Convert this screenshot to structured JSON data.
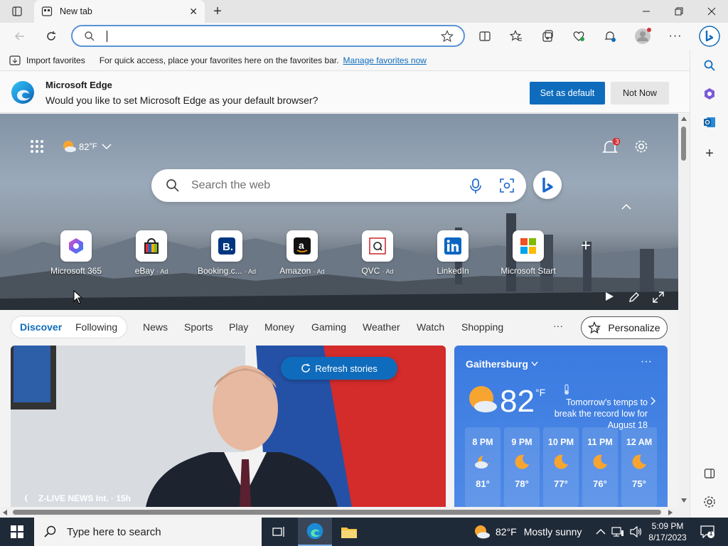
{
  "tab": {
    "title": "New tab"
  },
  "address": {
    "value": ""
  },
  "favorites_bar": {
    "import_label": "Import favorites",
    "message": "For quick access, place your favorites here on the favorites bar.",
    "manage_link": "Manage favorites now"
  },
  "banner": {
    "title": "Microsoft Edge",
    "message": "Would you like to set Microsoft Edge as your default browser?",
    "primary": "Set as default",
    "secondary": "Not Now"
  },
  "hero": {
    "weather": "82",
    "weather_unit": "°F",
    "search_placeholder": "Search the web",
    "notification_count": "3"
  },
  "tiles": [
    {
      "label": "Microsoft 365",
      "ad": ""
    },
    {
      "label": "eBay",
      "ad": "· Ad"
    },
    {
      "label": "Booking.c...",
      "ad": "· Ad"
    },
    {
      "label": "Amazon",
      "ad": "· Ad"
    },
    {
      "label": "QVC",
      "ad": "· Ad"
    },
    {
      "label": "LinkedIn",
      "ad": ""
    },
    {
      "label": "Microsoft Start",
      "ad": ""
    }
  ],
  "feed_nav": {
    "discover": "Discover",
    "following": "Following",
    "items": [
      "News",
      "Sports",
      "Play",
      "Money",
      "Gaming",
      "Weather",
      "Watch",
      "Shopping"
    ],
    "more": "···",
    "personalize": "Personalize"
  },
  "news": {
    "refresh": "Refresh stories",
    "source": "Z-LIVE NEWS Int. · 15h"
  },
  "weather_card": {
    "location": "Gaithersburg",
    "more": "···",
    "temp": "82",
    "unit": "°F",
    "note": "Tomorrow's temps to break the record low for August 18",
    "hourly": [
      {
        "time": "8 PM",
        "temp": "81°",
        "icon": "partly-cloudy-night-icon"
      },
      {
        "time": "9 PM",
        "temp": "78°",
        "icon": "moon-icon"
      },
      {
        "time": "10 PM",
        "temp": "77°",
        "icon": "moon-icon"
      },
      {
        "time": "11 PM",
        "temp": "76°",
        "icon": "moon-icon"
      },
      {
        "time": "12 AM",
        "temp": "75°",
        "icon": "moon-icon"
      }
    ]
  },
  "taskbar": {
    "search_placeholder": "Type here to search",
    "weather": "82°F",
    "weather_text": "Mostly sunny",
    "time": "5:09 PM",
    "date": "8/17/2023",
    "notification_count": "1"
  },
  "colors": {
    "accent": "#0f6cbd",
    "taskbar": "#1f2a38",
    "weather_card": "#3a7ae0"
  }
}
